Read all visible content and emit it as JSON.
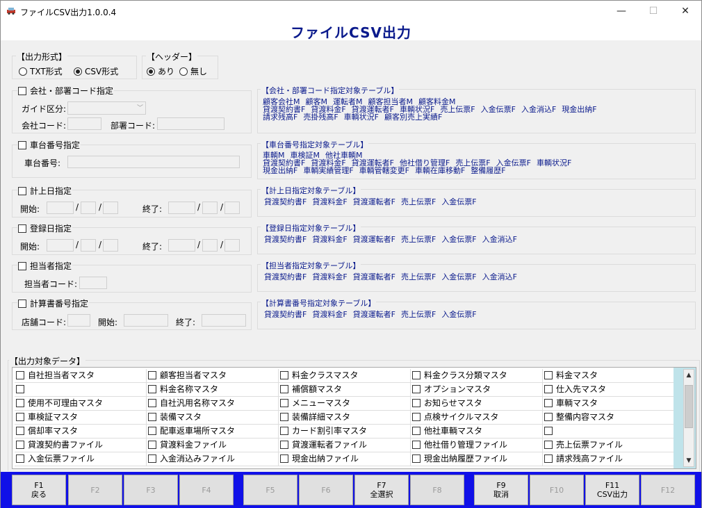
{
  "window": {
    "title": "ファイルCSV出力1.0.0.4",
    "minimize": "—",
    "maximize": "☐",
    "close": "✕"
  },
  "main_title": "ファイルCSV出力",
  "output_format": {
    "label": "【出力形式】",
    "options": [
      "TXT形式",
      "CSV形式"
    ],
    "selected": "CSV形式"
  },
  "header": {
    "label": "【ヘッダー】",
    "options": [
      "あり",
      "無し"
    ],
    "selected": "あり"
  },
  "company": {
    "label": "会社・部署コード指定",
    "guide_label": "ガイド区分:",
    "company_code_label": "会社コード:",
    "dept_code_label": "部署コード:"
  },
  "vehicle": {
    "label": "車台番号指定",
    "number_label": "車台番号:"
  },
  "accounting_date": {
    "label": "計上日指定",
    "start": "開始:",
    "end": "終了:"
  },
  "registration_date": {
    "label": "登録日指定",
    "start": "開始:",
    "end": "終了:"
  },
  "staff": {
    "label": "担当者指定",
    "code_label": "担当者コード:"
  },
  "statement": {
    "label": "計算書番号指定",
    "store_label": "店舗コード:",
    "start": "開始:",
    "end": "終了:"
  },
  "slash": "/",
  "tables": {
    "company": {
      "title": "【会社・部署コード指定対象テーブル】",
      "lines": [
        [
          "顧客会社M",
          "顧客M",
          "運転者M",
          "顧客担当者M",
          "顧客料金M"
        ],
        [
          "貸渡契約書F",
          "貸渡料金F",
          "貸渡運転者F",
          "車輌状況F",
          "売上伝票F",
          "入金伝票F",
          "入金消込F",
          "現金出納F"
        ],
        [
          "請求残高F",
          "売掛残高F",
          "車輌状況F",
          "顧客別売上実績F"
        ]
      ]
    },
    "vehicle": {
      "title": "【車台番号指定対象テーブル】",
      "lines": [
        [
          "車輌M",
          "車検証M",
          "他社車輌M"
        ],
        [
          "貸渡契約書F",
          "貸渡料金F",
          "貸渡運転者F",
          "他社借り管理F",
          "売上伝票F",
          "入金伝票F",
          "車輌状況F"
        ],
        [
          "現金出納F",
          "車輌実績管理F",
          "車輌管轄変更F",
          "車輌在庫移動F",
          "整備履歴F"
        ]
      ]
    },
    "accounting": {
      "title": "【計上日指定対象テーブル】",
      "lines": [
        [
          "貸渡契約書F",
          "貸渡料金F",
          "貸渡運転者F",
          "売上伝票F",
          "入金伝票F"
        ]
      ]
    },
    "registration": {
      "title": "【登録日指定対象テーブル】",
      "lines": [
        [
          "貸渡契約書F",
          "貸渡料金F",
          "貸渡運転者F",
          "売上伝票F",
          "入金伝票F",
          "入金消込F"
        ]
      ]
    },
    "staff": {
      "title": "【担当者指定対象テーブル】",
      "lines": [
        [
          "貸渡契約書F",
          "貸渡料金F",
          "貸渡運転者F",
          "売上伝票F",
          "入金伝票F",
          "入金消込F"
        ]
      ]
    },
    "statement": {
      "title": "【計算書番号指定対象テーブル】",
      "lines": [
        [
          "貸渡契約書F",
          "貸渡料金F",
          "貸渡運転者F",
          "売上伝票F",
          "入金伝票F"
        ]
      ]
    }
  },
  "output_data": {
    "label": "【出力対象データ】",
    "rows": [
      [
        "自社担当者マスタ",
        "顧客担当者マスタ",
        "料金クラスマスタ",
        "料金クラス分類マスタ",
        "料金マスタ"
      ],
      [
        "",
        "料金名称マスタ",
        "補償額マスタ",
        "オプションマスタ",
        "仕入先マスタ"
      ],
      [
        "使用不可理由マスタ",
        "自社汎用名称マスタ",
        "メニューマスタ",
        "お知らせマスタ",
        "車輌マスタ"
      ],
      [
        "車検証マスタ",
        "装備マスタ",
        "装備詳細マスタ",
        "点検サイクルマスタ",
        "整備内容マスタ"
      ],
      [
        "償却率マスタ",
        "配車返車場所マスタ",
        "カード割引率マスタ",
        "他社車輌マスタ",
        ""
      ],
      [
        "貸渡契約書ファイル",
        "貸渡料金ファイル",
        "貸渡運転者ファイル",
        "他社借り管理ファイル",
        "売上伝票ファイル"
      ],
      [
        "入金伝票ファイル",
        "入金消込みファイル",
        "現金出納ファイル",
        "現金出納履歴ファイル",
        "請求残高ファイル"
      ]
    ]
  },
  "scroll": {
    "up": "▲",
    "down": "▼"
  },
  "fkeys": [
    {
      "id": "F1",
      "label": "戻る",
      "enabled": true
    },
    {
      "id": "F2",
      "label": "",
      "enabled": false
    },
    {
      "id": "F3",
      "label": "",
      "enabled": false
    },
    {
      "id": "F4",
      "label": "",
      "enabled": false
    },
    {
      "id": "F5",
      "label": "",
      "enabled": false
    },
    {
      "id": "F6",
      "label": "",
      "enabled": false
    },
    {
      "id": "F7",
      "label": "全選択",
      "enabled": true
    },
    {
      "id": "F8",
      "label": "",
      "enabled": false
    },
    {
      "id": "F9",
      "label": "取消",
      "enabled": true
    },
    {
      "id": "F10",
      "label": "",
      "enabled": false
    },
    {
      "id": "F11",
      "label": "CSV出力",
      "enabled": true
    },
    {
      "id": "F12",
      "label": "",
      "enabled": false
    }
  ]
}
